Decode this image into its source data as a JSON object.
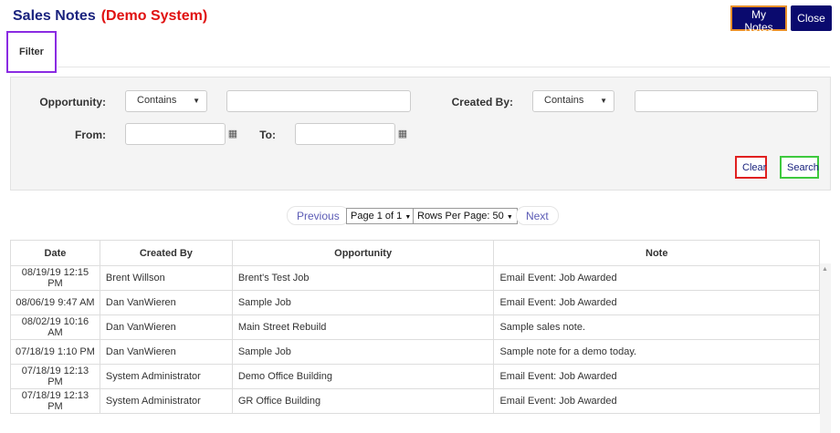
{
  "header": {
    "title": "Sales Notes",
    "subtitle": "(Demo System)",
    "my_notes_label": "My Notes",
    "close_label": "Close"
  },
  "tabs": [
    {
      "label": "Filter"
    }
  ],
  "filter": {
    "opportunity_label": "Opportunity:",
    "opportunity_mode": "Contains",
    "opportunity_value": "",
    "created_by_label": "Created By:",
    "created_by_mode": "Contains",
    "created_by_value": "",
    "from_label": "From:",
    "from_value": "",
    "to_label": "To:",
    "to_value": "",
    "clear_label": "Clear",
    "search_label": "Search"
  },
  "pagination": {
    "previous_label": "Previous",
    "page_select": "Page 1 of 1",
    "rows_select": "Rows Per Page: 50",
    "next_label": "Next"
  },
  "table": {
    "columns": [
      "Date",
      "Created By",
      "Opportunity",
      "Note"
    ],
    "rows": [
      [
        "08/19/19 12:15 PM",
        "Brent Willson",
        "Brent's Test Job",
        "Email Event: Job Awarded"
      ],
      [
        "08/06/19 9:47 AM",
        "Dan VanWieren",
        "Sample Job",
        "Email Event: Job Awarded"
      ],
      [
        "08/02/19 10:16 AM",
        "Dan VanWieren",
        "Main Street Rebuild",
        "Sample sales note."
      ],
      [
        "07/18/19 1:10 PM",
        "Dan VanWieren",
        "Sample Job",
        "Sample note for a demo today."
      ],
      [
        "07/18/19 12:13 PM",
        "System Administrator",
        "Demo Office Building",
        "Email Event: Job Awarded"
      ],
      [
        "07/18/19 12:13 PM",
        "System Administrator",
        "GR Office Building",
        "Email Event: Job Awarded"
      ]
    ]
  },
  "icons": {
    "calendar": "calendar-icon",
    "caret": "caret-down-icon"
  },
  "colors": {
    "title": "#1a237e",
    "demo": "#e01010",
    "primary_button": "#0a0a6e"
  }
}
